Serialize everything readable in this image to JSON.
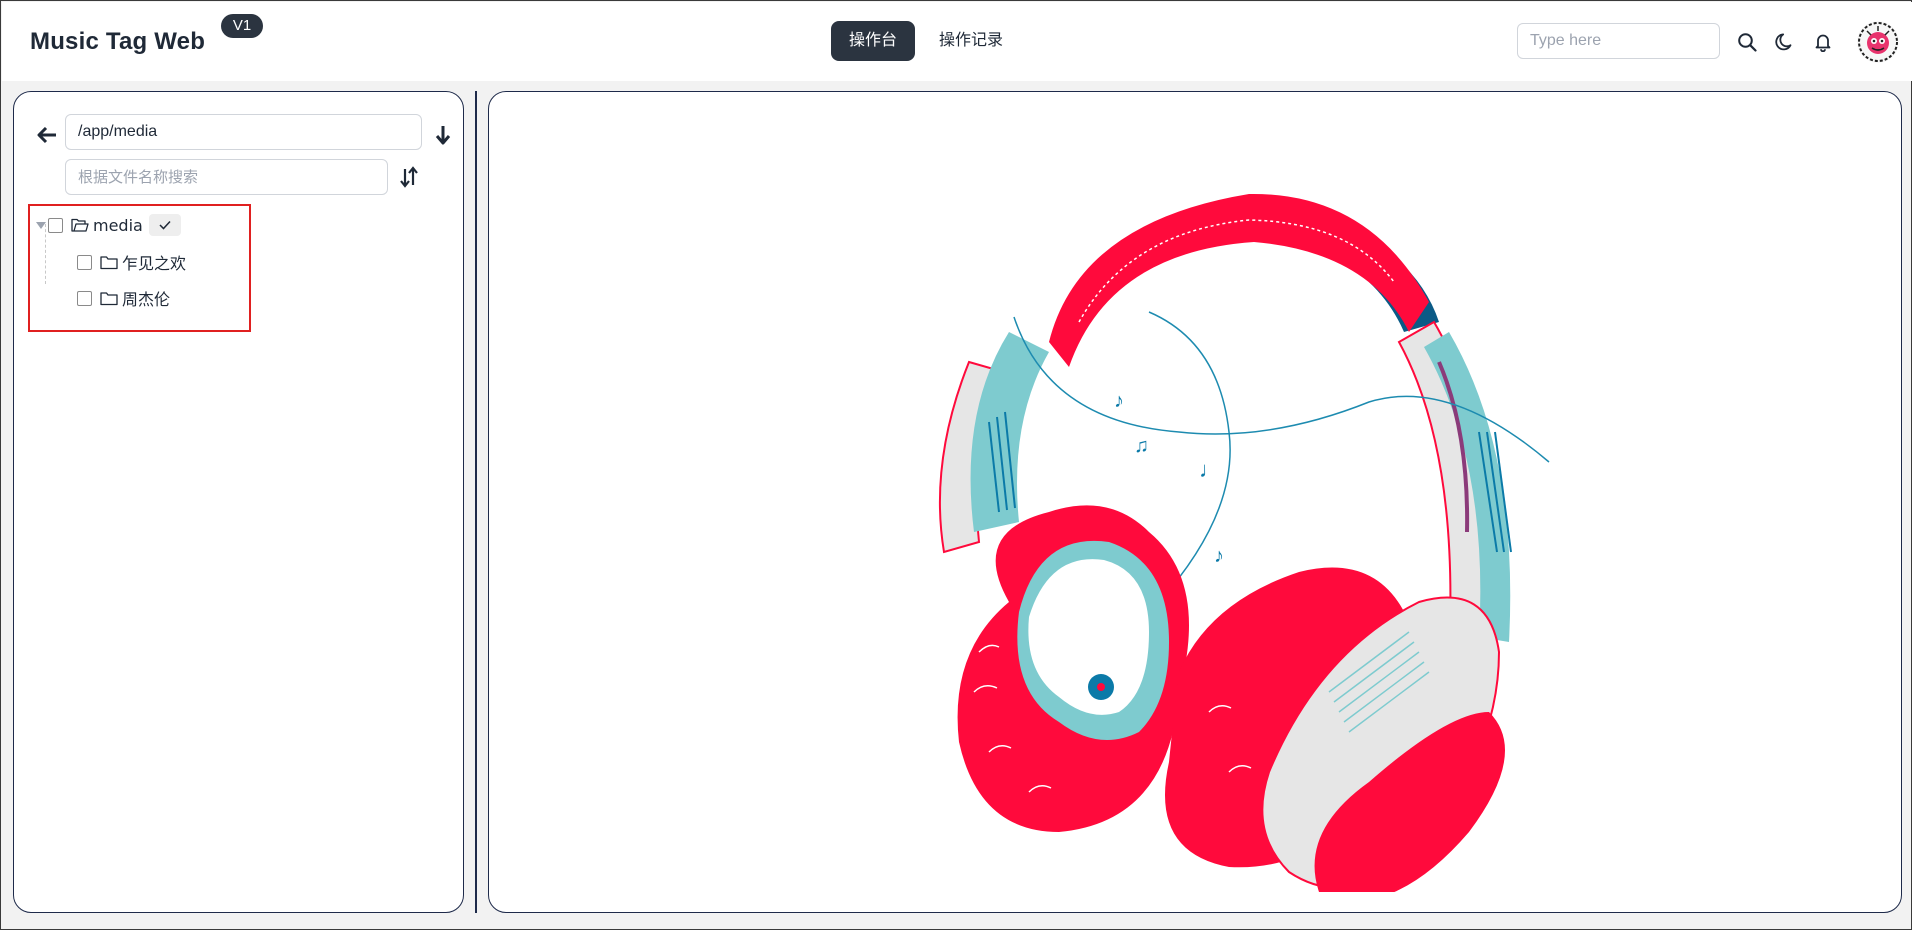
{
  "header": {
    "brand": "Music Tag Web",
    "version": "V1",
    "tabs": [
      {
        "label": "操作台",
        "active": true
      },
      {
        "label": "操作记录",
        "active": false
      }
    ],
    "search_placeholder": "Type here",
    "icons": [
      "search-icon",
      "moon-icon",
      "bell-icon"
    ]
  },
  "sidebar": {
    "path_value": "/app/media",
    "filter_placeholder": "根据文件名称搜索",
    "tree": {
      "root": {
        "label": "media",
        "expanded": true,
        "checked": false
      },
      "children": [
        {
          "label": "乍见之欢",
          "checked": false
        },
        {
          "label": "周杰伦",
          "checked": false
        }
      ]
    }
  },
  "colors": {
    "accent_dark": "#2b3440",
    "panel_border": "#1e2a4a",
    "highlight_box": "#e02020",
    "headphone_red": "#ff0a3c",
    "headphone_teal": "#7ecbcf",
    "headphone_blue": "#0b7aa8"
  }
}
